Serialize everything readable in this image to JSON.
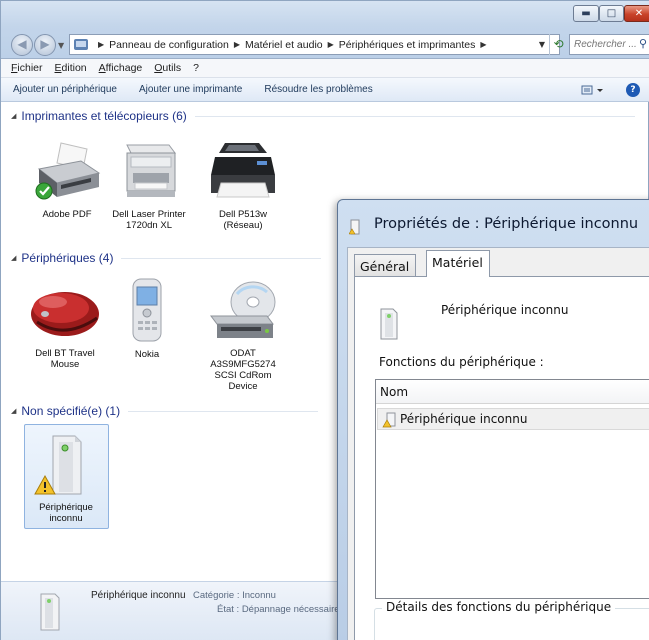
{
  "window": {
    "address": [
      "Panneau de configuration",
      "Matériel et audio",
      "Périphériques et imprimantes"
    ],
    "search_placeholder": "Rechercher ...",
    "controls": {
      "min": "▬",
      "max": "□",
      "close": "✕"
    }
  },
  "menu": [
    "Fichier",
    "Edition",
    "Affichage",
    "Outils",
    "?"
  ],
  "commands": [
    "Ajouter un périphérique",
    "Ajouter une imprimante",
    "Résoudre les problèmes"
  ],
  "groups": {
    "printers": "Imprimantes et télécopieurs (6)",
    "devices": "Périphériques (4)",
    "unspecified": "Non spécifié(e) (1)"
  },
  "printers": [
    {
      "name": "Adobe PDF",
      "icon": "printer-default-icon"
    },
    {
      "name": "Dell Laser Printer 1720dn XL",
      "icon": "laser-printer-icon"
    },
    {
      "name": "Dell P513w (Réseau)",
      "icon": "inkjet-printer-icon"
    }
  ],
  "devices": [
    {
      "name": "Dell BT Travel Mouse",
      "icon": "mouse-icon"
    },
    {
      "name": "Nokia",
      "icon": "phone-icon"
    },
    {
      "name": "ODAT A3S9MFG5274 SCSI CdRom Device",
      "icon": "cdrom-icon"
    }
  ],
  "unspecified": [
    {
      "name": "Périphérique inconnu",
      "icon": "unknown-device-icon"
    }
  ],
  "details": {
    "name": "Périphérique inconnu",
    "category": "Catégorie : Inconnu",
    "state": "État : Dépannage nécessaire"
  },
  "dialog": {
    "title": "Propriétés de : Périphérique inconnu",
    "tabs": [
      "Général",
      "Matériel"
    ],
    "device_name": "Périphérique inconnu",
    "functions_label": "Fonctions du périphérique :",
    "column_name": "Nom",
    "function_row": "Périphérique inconnu",
    "details_label": "Détails des fonctions du périphérique"
  },
  "colors": {
    "group_heading": "#1e3287",
    "command_text": "#1e395b",
    "selection": "#dbe8f7"
  }
}
